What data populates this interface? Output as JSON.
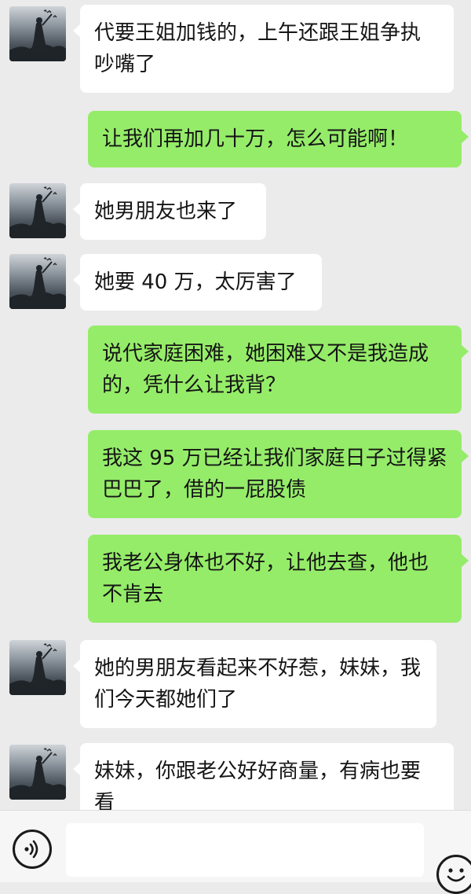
{
  "messages": [
    {
      "side": "in",
      "text": "代要王姐加钱的，上午还跟王姐争执吵嘴了"
    },
    {
      "side": "out",
      "text": "让我们再加几十万，怎么可能啊！"
    },
    {
      "side": "in",
      "text": "她男朋友也来了"
    },
    {
      "side": "in",
      "text": "她要 40 万，太厉害了"
    },
    {
      "side": "out",
      "text": "说代家庭困难，她困难又不是我造成的，凭什么让我背？"
    },
    {
      "side": "out",
      "text": "我这 95 万已经让我们家庭日子过得紧巴巴了，借的一屁股债"
    },
    {
      "side": "out",
      "text": "我老公身体也不好，让他去查，他也不肯去"
    },
    {
      "side": "in",
      "text": "她的男朋友看起来不好惹，妹妹，我们今天都她们了"
    },
    {
      "side": "in",
      "text": "妹妹，你跟老公好好商量，有病也要看"
    }
  ],
  "icons": {
    "voice": "voice-icon",
    "emoji": "emoji-icon"
  },
  "colors": {
    "outgoing_bubble": "#95ec69",
    "incoming_bubble": "#ffffff",
    "background": "#ebebeb"
  }
}
